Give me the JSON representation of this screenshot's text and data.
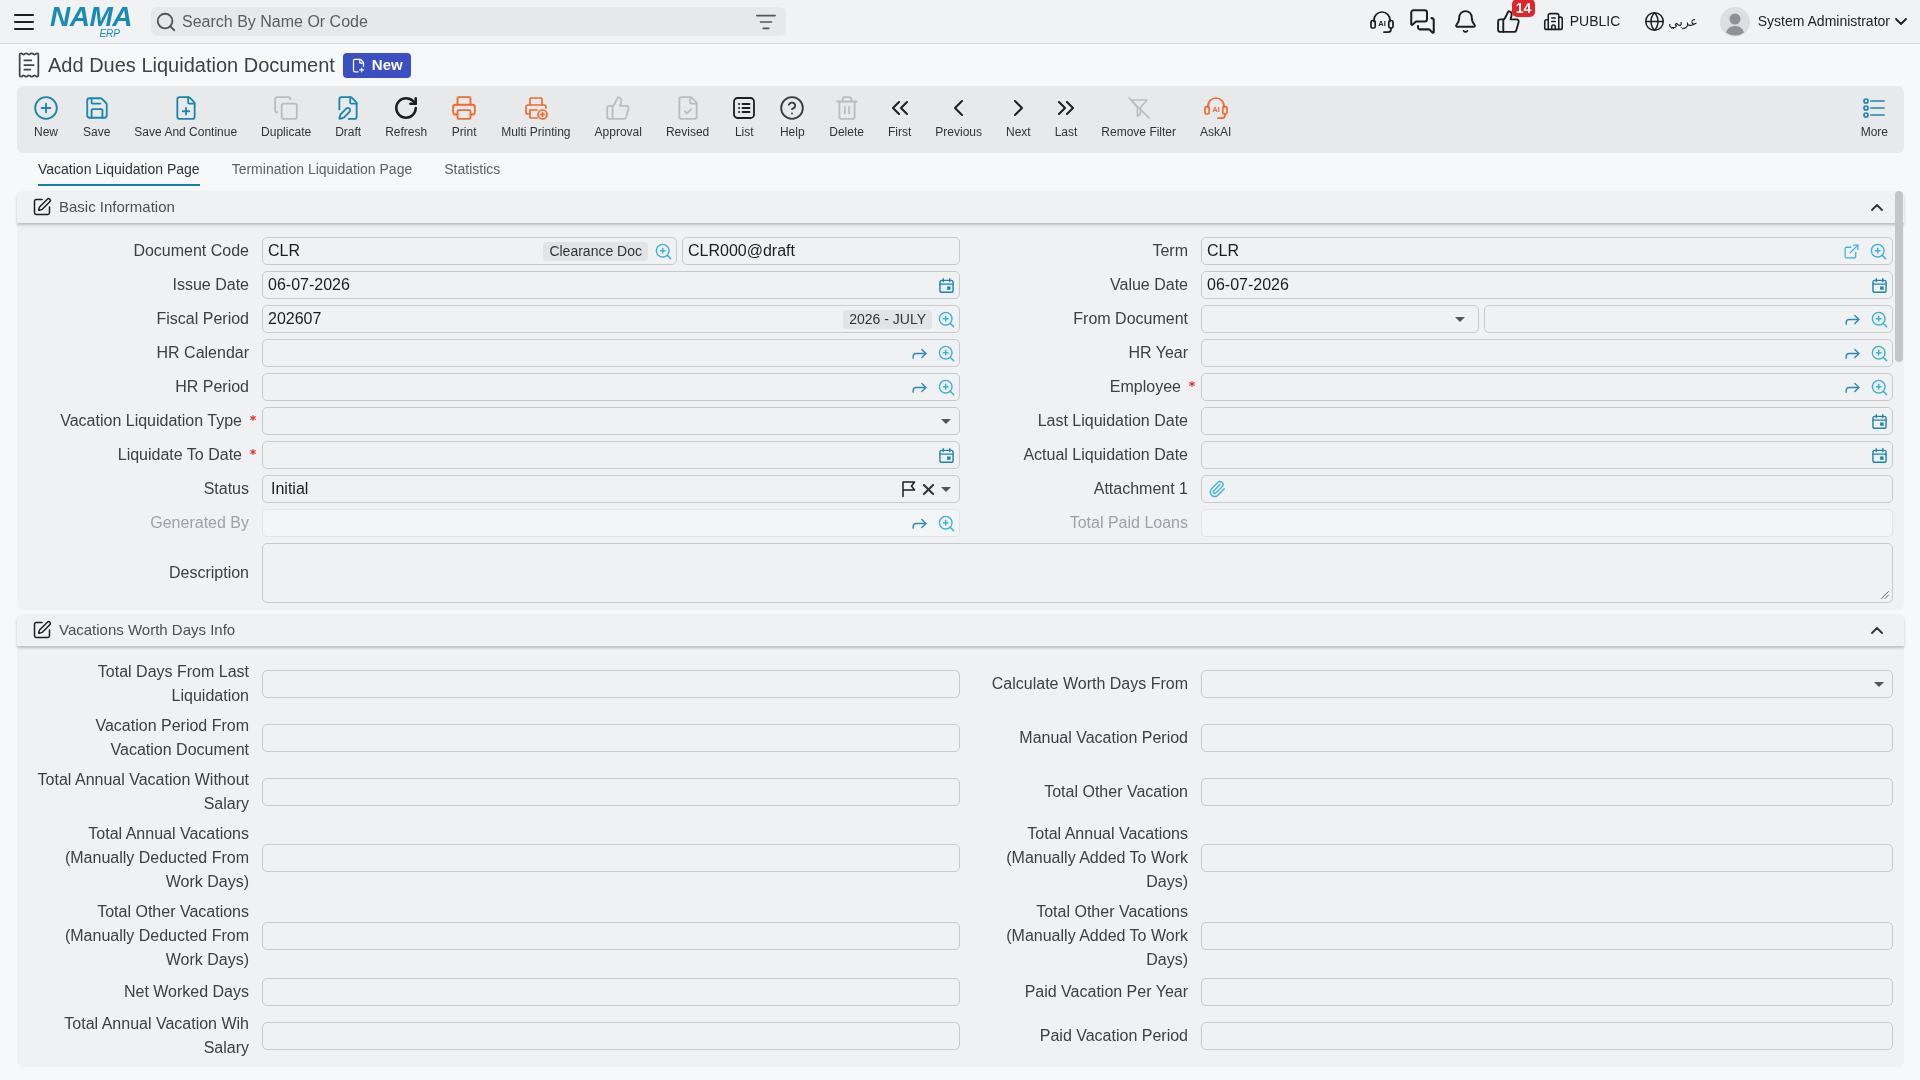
{
  "top_bar": {
    "logo": "NAMA",
    "logo_suffix": "ERP",
    "search": {
      "placeholder": "Search By Name Or Code"
    },
    "assistant_label": "AI",
    "notification_count": "14",
    "company": "PUBLIC",
    "language": "عربي",
    "user": "System Administrator"
  },
  "document": {
    "title": "Add Dues Liquidation Document",
    "badge": "New"
  },
  "toolbar": {
    "actions": [
      {
        "label": "New",
        "disabled": false
      },
      {
        "label": "Save",
        "disabled": false
      },
      {
        "label": "Save And Continue",
        "disabled": false
      },
      {
        "label": "Duplicate",
        "disabled": true
      },
      {
        "label": "Draft",
        "disabled": false
      },
      {
        "label": "Refresh",
        "disabled": false
      },
      {
        "label": "Print",
        "disabled": false
      },
      {
        "label": "Multi Printing",
        "disabled": false
      },
      {
        "label": "Approval",
        "disabled": true
      },
      {
        "label": "Revised",
        "disabled": true
      },
      {
        "label": "List",
        "disabled": false
      },
      {
        "label": "Help",
        "disabled": false
      },
      {
        "label": "Delete",
        "disabled": true
      },
      {
        "label": "First",
        "disabled": false
      },
      {
        "label": "Previous",
        "disabled": false
      },
      {
        "label": "Next",
        "disabled": false
      },
      {
        "label": "Last",
        "disabled": false
      },
      {
        "label": "Remove Filter",
        "disabled": true
      },
      {
        "label": "AskAI",
        "disabled": false,
        "icon_text": "AI"
      }
    ],
    "more": "More"
  },
  "tabs": [
    {
      "label": "Vacation Liquidation Page",
      "selected": true
    },
    {
      "label": "Termination Liquidation Page",
      "selected": false
    },
    {
      "label": "Statistics",
      "selected": false
    }
  ],
  "sections": [
    {
      "title": "Basic Information",
      "expanded": true,
      "rows": [
        [
          {
            "label": "Document Code",
            "kind": "code",
            "required": false,
            "disabled": false,
            "value": "CLR",
            "chip": "Clearance Doc",
            "code": "CLR000@draft"
          },
          {
            "label": "Term",
            "kind": "external",
            "required": false,
            "disabled": false,
            "value": "CLR"
          }
        ],
        [
          {
            "label": "Issue Date",
            "kind": "date",
            "required": false,
            "disabled": false,
            "value": "06-07-2026"
          },
          {
            "label": "Value Date",
            "kind": "date",
            "required": false,
            "disabled": false,
            "value": "06-07-2026"
          }
        ],
        [
          {
            "label": "Fiscal Period",
            "kind": "search",
            "required": false,
            "disabled": false,
            "value": "202607",
            "chip": "2026 - JULY"
          },
          {
            "label": "From Document",
            "kind": "split",
            "required": false,
            "disabled": false
          }
        ],
        [
          {
            "label": "HR Calendar",
            "kind": "lookup",
            "required": false,
            "disabled": false
          },
          {
            "label": "HR Year",
            "kind": "lookup",
            "required": false,
            "disabled": false
          }
        ],
        [
          {
            "label": "HR Period",
            "kind": "lookup",
            "required": false,
            "disabled": false
          },
          {
            "label": "Employee",
            "kind": "lookup",
            "required": true,
            "disabled": false
          }
        ],
        [
          {
            "label": "Vacation Liquidation Type",
            "kind": "select",
            "required": true,
            "disabled": false
          },
          {
            "label": "Last Liquidation Date",
            "kind": "date",
            "required": false,
            "disabled": false
          }
        ],
        [
          {
            "label": "Liquidate To Date",
            "kind": "date",
            "required": true,
            "disabled": false
          },
          {
            "label": "Actual Liquidation Date",
            "kind": "date",
            "required": false,
            "disabled": false
          }
        ],
        [
          {
            "label": "Status",
            "kind": "status",
            "required": false,
            "disabled": false,
            "value": "Initial"
          },
          {
            "label": "Attachment 1",
            "kind": "attachment",
            "required": false,
            "disabled": false
          }
        ],
        [
          {
            "label": "Generated By",
            "kind": "lookup",
            "required": false,
            "disabled": true
          },
          {
            "label": "Total Paid Loans",
            "kind": "text",
            "required": false,
            "disabled": true
          }
        ],
        [
          {
            "label": "Description",
            "kind": "textarea",
            "required": false,
            "disabled": false
          }
        ]
      ]
    },
    {
      "title": "Vacations Worth Days Info",
      "expanded": true,
      "rows": [
        [
          {
            "label": "Total Days From Last Liquidation",
            "kind": "text",
            "required": false,
            "disabled": false
          },
          {
            "label": "Calculate Worth Days From",
            "kind": "select",
            "required": false,
            "disabled": false
          }
        ],
        [
          {
            "label": "Vacation Period From Vacation Document",
            "kind": "text",
            "required": false,
            "disabled": false
          },
          {
            "label": "Manual Vacation Period",
            "kind": "text",
            "required": false,
            "disabled": false
          }
        ],
        [
          {
            "label": "Total Annual Vacation Without Salary",
            "kind": "text",
            "required": false,
            "disabled": false
          },
          {
            "label": "Total Other Vacation",
            "kind": "text",
            "required": false,
            "disabled": false
          }
        ],
        [
          {
            "label": "Total Annual Vacations (Manually Deducted From Work Days)",
            "kind": "text",
            "required": false,
            "disabled": false
          },
          {
            "label": "Total Annual Vacations (Manually Added To Work Days)",
            "kind": "text",
            "required": false,
            "disabled": false
          }
        ],
        [
          {
            "label": "Total Other Vacations (Manually Deducted From Work Days)",
            "kind": "text",
            "required": false,
            "disabled": false
          },
          {
            "label": "Total Other Vacations (Manually Added To Work Days)",
            "kind": "text",
            "required": false,
            "disabled": false
          }
        ],
        [
          {
            "label": "Net Worked Days",
            "kind": "text",
            "required": false,
            "disabled": false
          },
          {
            "label": "Paid Vacation Per Year",
            "kind": "text",
            "required": false,
            "disabled": false
          }
        ],
        [
          {
            "label": "Total Annual Vacation Wih Salary",
            "kind": "text",
            "required": false,
            "disabled": false
          },
          {
            "label": "Paid Vacation Period",
            "kind": "text",
            "required": false,
            "disabled": false
          }
        ]
      ]
    }
  ]
}
